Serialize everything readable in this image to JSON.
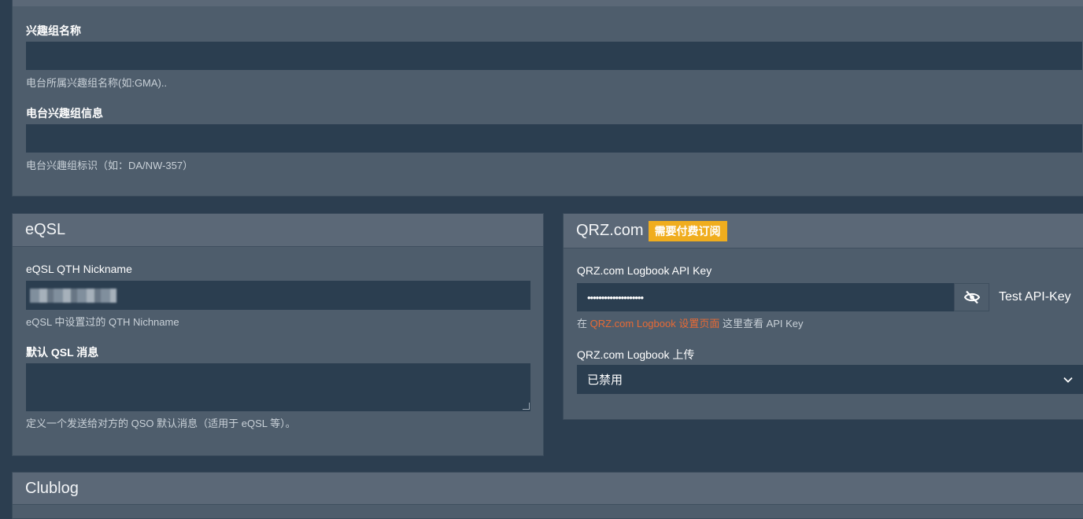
{
  "sota": {
    "group_name_label": "兴趣组名称",
    "group_name_value": "",
    "group_name_help": "电台所属兴趣组名称(如:GMA)..",
    "group_info_label": "电台兴趣组信息",
    "group_info_value": "",
    "group_info_help": "电台兴趣组标识（如：DA/NW-357）"
  },
  "eqsl": {
    "title": "eQSL",
    "nickname_label": "eQSL QTH Nickname",
    "nickname_help": "eQSL 中设置过的 QTH Nichname",
    "qsl_msg_label": "默认 QSL 消息",
    "qsl_msg_value": "",
    "qsl_msg_help": "定义一个发送给对方的 QSO 默认消息（适用于 eQSL 等）。"
  },
  "qrz": {
    "title": "QRZ.com",
    "badge": "需要付费订阅",
    "api_key_label": "QRZ.com Logbook API Key",
    "api_key_value": "••••••••••••••••••••",
    "test_button": "Test API-Key",
    "help_prefix": "在 ",
    "help_link": "QRZ.com Logbook 设置页面",
    "help_suffix": " 这里查看 API Key",
    "upload_label": "QRZ.com Logbook 上传",
    "upload_value": "已禁用",
    "colors": {
      "badge": "#f0ad1e",
      "link": "#e86a35"
    }
  },
  "clublog": {
    "title": "Clublog"
  }
}
